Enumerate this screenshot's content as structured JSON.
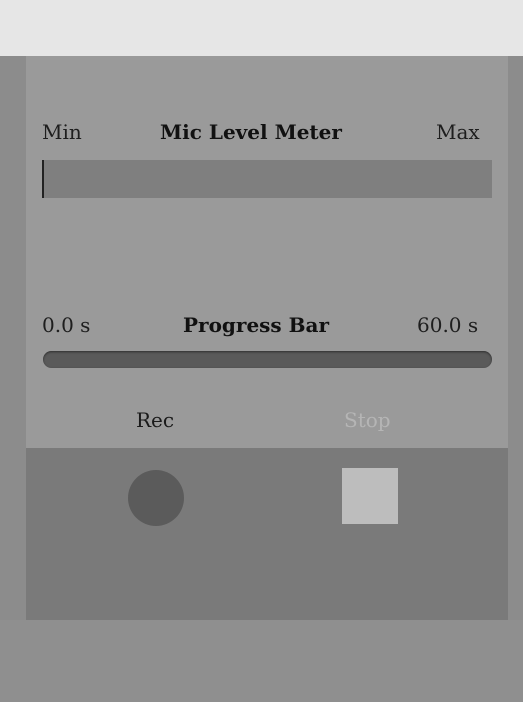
{
  "mic_meter": {
    "title": "Mic Level Meter",
    "min_label": "Min",
    "max_label": "Max",
    "level": 0.0
  },
  "progress": {
    "title": "Progress Bar",
    "start_label": "0.0 s",
    "end_label": "60.0 s",
    "fraction": 0.0
  },
  "buttons": {
    "rec_label": "Rec",
    "stop_label": "Stop",
    "stop_enabled": false
  },
  "icons": {
    "record": "record-icon",
    "stop": "stop-icon"
  },
  "colors": {
    "panel": "#9a9a9a",
    "controls_area": "#7a7a7a",
    "record_button": "#5b5b5b",
    "stop_button": "#bdbdbd",
    "disabled_text": "#b5b5b5"
  }
}
